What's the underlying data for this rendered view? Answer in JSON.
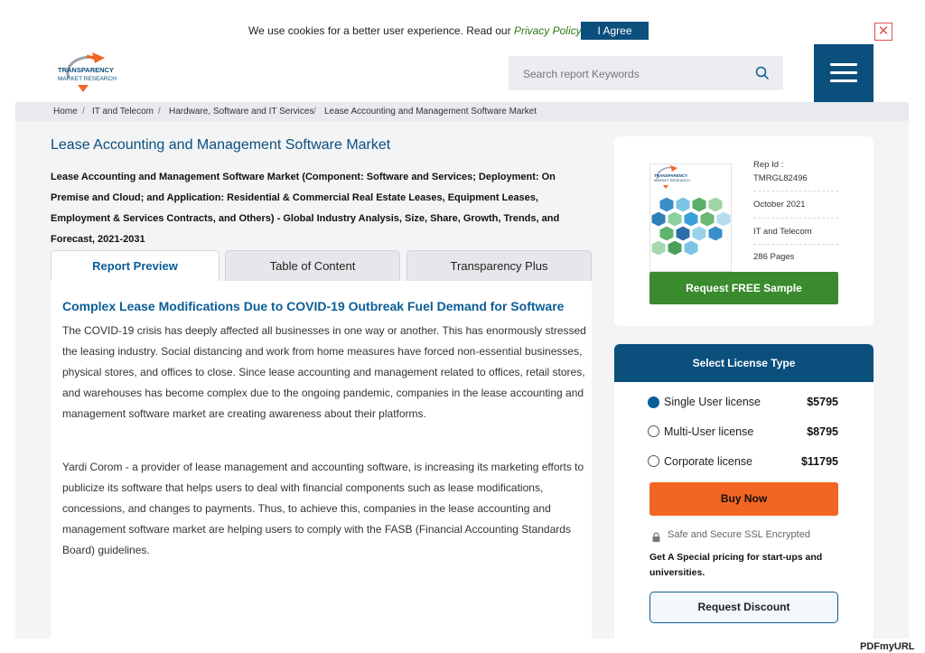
{
  "cookie": {
    "text": "We use cookies for a better user experience. Read our",
    "link": "Privacy Policy",
    "agree_label": "I Agree",
    "close_glyph": "✕"
  },
  "header": {
    "logo_line1": "TRANSPARENCY",
    "logo_line2": "MARKET RESEARCH",
    "search_placeholder": "Search report Keywords"
  },
  "breadcrumb": [
    "Home",
    "IT and Telecom",
    "Hardware, Software and IT Services",
    "Lease Accounting and Management Software Market"
  ],
  "breadcrumb_sep": "/",
  "page": {
    "title": "Lease Accounting and Management Software Market",
    "subtitle": "Lease Accounting and Management Software Market (Component: Software and Services; Deployment: On Premise and Cloud; and Application: Residential & Commercial Real Estate Leases, Equipment Leases, Employment & Services Contracts, and Others) - Global Industry Analysis, Size, Share, Growth, Trends, and Forecast, 2021-2031"
  },
  "tabs": [
    {
      "label": "Report Preview",
      "active": true
    },
    {
      "label": "Table of Content",
      "active": false
    },
    {
      "label": "Transparency Plus",
      "active": false
    }
  ],
  "content": {
    "section_title": "Complex Lease Modifications Due to COVID-19 Outbreak Fuel Demand for Software",
    "para1": "The COVID-19 crisis has deeply affected all businesses in one way or another. This has enormously stressed the leasing industry. Social distancing and work from home measures have forced non-essential businesses, physical stores, and offices to close. Since lease accounting and management related to offices, retail stores, and warehouses has become complex due to the ongoing pandemic, companies in the lease accounting and management software market are creating awareness about their platforms.",
    "para2": "Yardi Corom - a provider of lease management and accounting software, is increasing its marketing efforts to publicize its software that helps users to deal with financial components such as lease modifications, concessions, and changes to payments. Thus, to achieve this, companies in the lease accounting and management software market are helping users to comply with the FASB (Financial Accounting Standards Board) guidelines."
  },
  "report": {
    "rep_id_label": "Rep Id :",
    "rep_id": "TMRGL82496",
    "date": "October 2021",
    "category": "IT and Telecom",
    "pages": "286 Pages",
    "request_sample": "Request FREE Sample"
  },
  "license": {
    "heading": "Select License Type",
    "options": [
      {
        "name": "Single User license",
        "price": "$5795",
        "selected": true
      },
      {
        "name": "Multi-User license",
        "price": "$8795",
        "selected": false
      },
      {
        "name": "Corporate license",
        "price": "$11795",
        "selected": false
      }
    ],
    "buy_label": "Buy Now",
    "ssl_text": "Safe and Secure SSL Encrypted",
    "special_text": "Get A Special pricing for start-ups and universities.",
    "discount_label": "Request Discount"
  },
  "watermark": "PDFmyURL",
  "colors": {
    "brand_blue": "#0b4f7d",
    "link_blue": "#0b5d96",
    "green": "#3a8a2e",
    "orange": "#f26522"
  }
}
